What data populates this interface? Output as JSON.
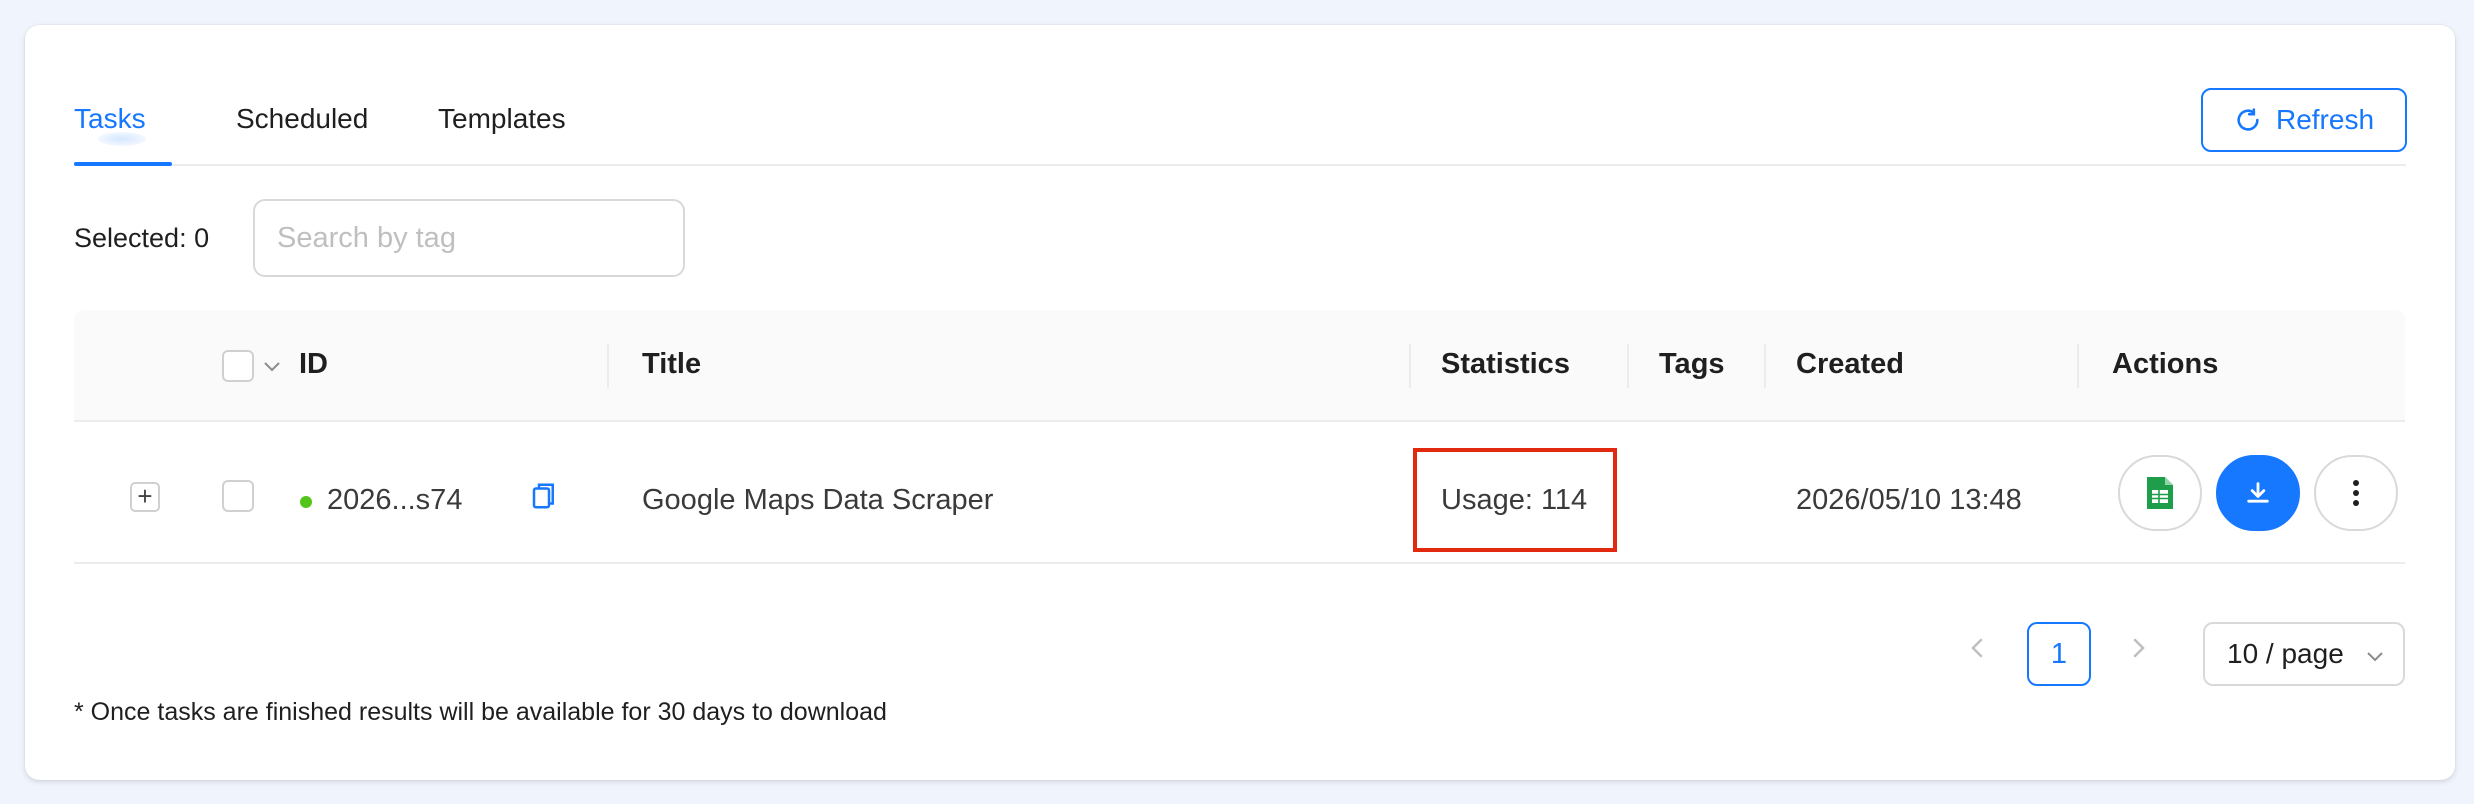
{
  "tabs": [
    {
      "label": "Tasks",
      "active": true
    },
    {
      "label": "Scheduled",
      "active": false
    },
    {
      "label": "Templates",
      "active": false
    }
  ],
  "toolbar": {
    "refresh_label": "Refresh"
  },
  "selection": {
    "selected_text": "Selected: 0"
  },
  "search": {
    "placeholder": "Search by tag",
    "value": ""
  },
  "table": {
    "columns": {
      "id": "ID",
      "title": "Title",
      "statistics": "Statistics",
      "tags": "Tags",
      "created": "Created",
      "actions": "Actions"
    },
    "rows": [
      {
        "expand_symbol": "+",
        "status": "success",
        "id": "2026...s74",
        "title": "Google Maps Data Scraper",
        "statistics": "Usage: 114",
        "tags": "",
        "created": "2026/05/10 13:48"
      }
    ]
  },
  "pagination": {
    "current_page": "1",
    "page_size": "10 / page"
  },
  "footnote": "* Once tasks are finished results will be available for 30 days to download",
  "colors": {
    "accent": "#1677ff",
    "success": "#52c41a",
    "highlight": "#e0290e",
    "sheets_green": "#1e9e4a"
  },
  "icons": [
    "refresh-icon",
    "copy-icon",
    "spreadsheet-icon",
    "download-icon",
    "more-vertical-icon",
    "chevron-down-icon",
    "chevron-left-icon",
    "chevron-right-icon"
  ]
}
